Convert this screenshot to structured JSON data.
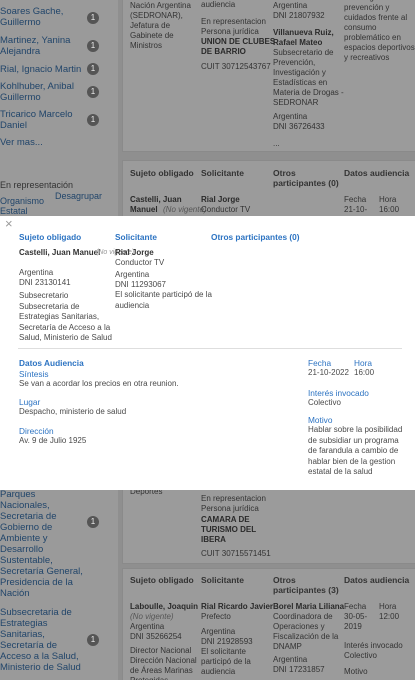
{
  "background": {
    "sidebar": {
      "items": [
        {
          "label": "Soares Gache,\nGuillermo",
          "count": "1"
        },
        {
          "label": "Martinez, Yanina\nAlejandra",
          "count": "1"
        },
        {
          "label": "Rial, Ignacio Martin",
          "count": "1"
        },
        {
          "label": "Kohlhuber, Anibal\nGuillermo",
          "count": "1"
        },
        {
          "label": "Tricarico Marcelo\nDaniel",
          "count": "1"
        }
      ],
      "more_link": "Ver mas...",
      "representation_label": "En representación",
      "group_label": "Organismo\nEstatal",
      "group_toggle": "Desagrupar",
      "lower_items": [
        {
          "label": "Parques\nNacionales,\nSecretaria de\nGobierno de\nAmbiente y\nDesarrollo\nSustentable,\nSecretaría General,\nPresidencia de la\nNación",
          "count": "1"
        },
        {
          "label": "Subsecretaria de\nEstrategias\nSanitarias,\nSecretaría de\nAcceso a la Salud,\nMinisterio de Salud",
          "count": "1"
        }
      ]
    },
    "top_card": {
      "obligado_text": "Nación Argentina\n(SEDRONAR),\nJefatura de\nGabinete de\nMinistros",
      "solicitante_top": "audiencia",
      "solicitante_rep": "En representacion\nPersona jurídica",
      "solicitante_org": "UNION DE CLUBES\nDE BARRIO",
      "solicitante_cuit": "CUIT 30712543767",
      "otros_top": "Argentina\nDNI 21807932",
      "otros_name": "Villanueva Ruiz,\nRafael Mateo",
      "otros_role": "Subsecretario de\nPrevención,\nInvestigación y\nEstadísticas en\nMateria de Drogas -\nSEDRONAR",
      "otros_country": "Argentina\nDNI 36726433",
      "otros_more": "...",
      "datos_text": "Estrategias de\nprevención y\ncuidados frente al\nconsumo\nproblemático en\nespacios deportivos\ny recreativos"
    },
    "second_card": {
      "headers": [
        "Sujeto obligado",
        "Solicitante",
        "Otros\nparticipantes (0)",
        "Datos audiencia"
      ],
      "obligado": "Castelli, Juan\nManuel",
      "obligado_note": "(No vigente)",
      "solicitante": "Rial Jorge",
      "solicitante_role": "Conductor TV",
      "fecha_label": "Fecha",
      "fecha": "21-10-",
      "hora_label": "Hora",
      "hora": "16:00"
    },
    "third_card": {
      "obligado_tail": "Deportes",
      "solicitante_rep": "En representacion\nPersona jurídica",
      "solicitante_org": "CAMARA DE\nTURISMO DEL\nIBERA",
      "solicitante_cuit": "CUIT 30715571451"
    },
    "fourth_card": {
      "headers": [
        "Sujeto obligado",
        "Solicitante",
        "Otros\nparticipantes (3)",
        "Datos audiencia"
      ],
      "obligado": "Laboulle, Joaquin",
      "obligado_note": "(No vigente)",
      "obligado_details": "Argentina\nDNI 35266254",
      "obligado_role": "Director Nacional\nDirección Nacional\nde Áreas Marinas\nProtegidas",
      "solicitante": "Rial Ricardo Javier",
      "solicitante_role": "Prefecto",
      "solicitante_details": "Argentina\nDNI 21928593\nEl solicitante\nparticipó de la\naudiencia",
      "otros_name": "Borel Maria Liliana",
      "otros_role": "Coordinadora de\nOperaciones y\nFiscalización de la\nDNAMP",
      "otros_details": "Argentina\nDNI 17231857",
      "fecha_label": "Fecha",
      "fecha": "30-05-\n2019",
      "hora_label": "Hora",
      "hora": "12:00",
      "interes_label": "Interés invocado",
      "interes": "Colectivo",
      "motivo_label": "Motivo"
    }
  },
  "modal": {
    "close_icon": "×",
    "headers": {
      "sujeto": "Sujeto obligado",
      "solicitante": "Solicitante",
      "otros": "Otros participantes (0)"
    },
    "sujeto": {
      "name": "Castelli, Juan Manuel",
      "note": "(No vigente)",
      "country": "Argentina",
      "dni": "DNI 23130141",
      "role": "Subsecretario\nSubsecretaria de\nEstrategias Sanitarias,\nSecretaría de Acceso a la\nSalud, Ministerio de Salud"
    },
    "solicitante": {
      "name": "Rial Jorge",
      "role": "Conductor TV",
      "country": "Argentina",
      "dni": "DNI 11293067",
      "note": "El solicitante participó de la\naudiencia"
    },
    "datos": {
      "title": "Datos Audiencia",
      "sintesis_label": "Síntesis",
      "sintesis": "Se van a acordar los precios en otra reunion.",
      "lugar_label": "Lugar",
      "lugar": "Despacho, ministerio de salud",
      "direccion_label": "Dirección",
      "direccion": "Av. 9 de Julio 1925"
    },
    "fecha_label": "Fecha",
    "fecha": "21-10-2022",
    "hora_label": "Hora",
    "hora": "16:00",
    "interes_label": "Interés invocado",
    "interes": "Colectivo",
    "motivo_label": "Motivo",
    "motivo": "Hablar sobre la posibilidad\nde subsidiar un programa\nde farandula a cambio de\nhablar bien de la gestion\nestatal de la salud"
  }
}
